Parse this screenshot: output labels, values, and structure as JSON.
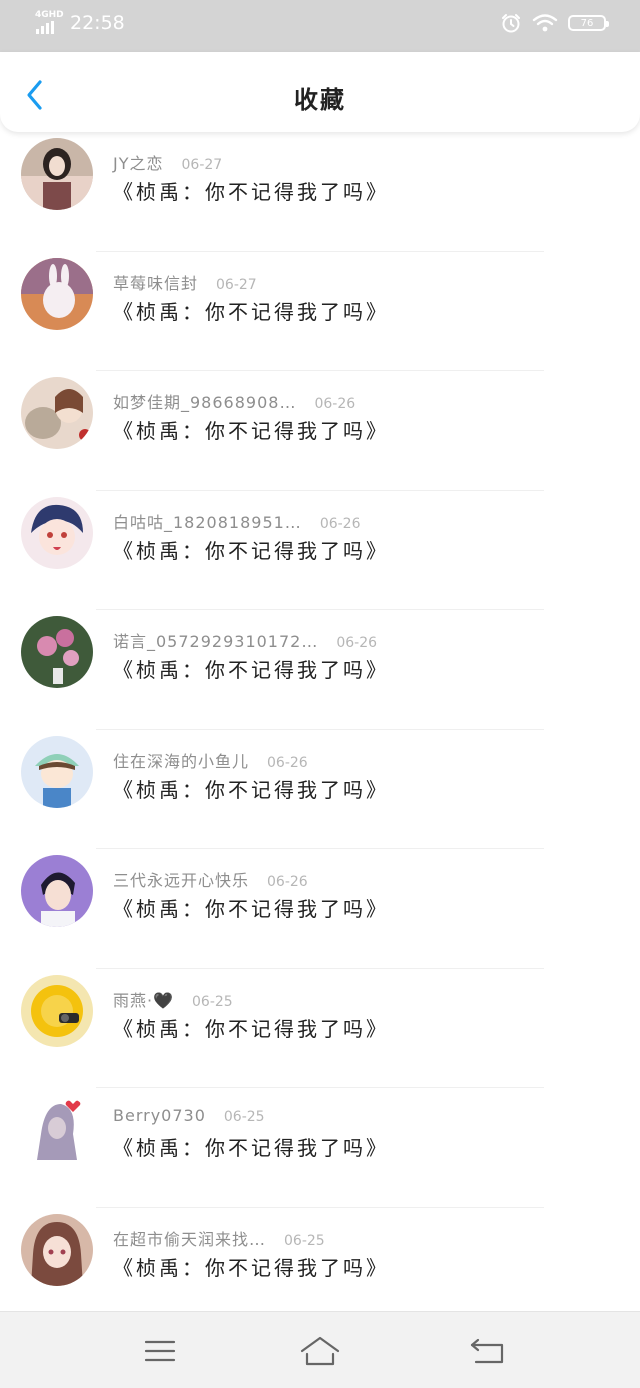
{
  "status_bar": {
    "network": "4GHD",
    "time": "22:58",
    "battery": "76"
  },
  "header": {
    "title": "收藏"
  },
  "favorites": [
    {
      "name": "JY之恋",
      "date": "06-27",
      "message": "《桢禹：你不记得我了吗》"
    },
    {
      "name": "草莓味信封",
      "date": "06-27",
      "message": "《桢禹：你不记得我了吗》"
    },
    {
      "name": "如梦佳期_98668908…",
      "date": "06-26",
      "message": "《桢禹：你不记得我了吗》"
    },
    {
      "name": "白咕咕_1820818951…",
      "date": "06-26",
      "message": "《桢禹：你不记得我了吗》"
    },
    {
      "name": "诺言_0572929310172…",
      "date": "06-26",
      "message": "《桢禹：你不记得我了吗》"
    },
    {
      "name": "住在深海的小鱼儿",
      "date": "06-26",
      "message": "《桢禹：你不记得我了吗》"
    },
    {
      "name": "三代永远开心快乐",
      "date": "06-26",
      "message": "《桢禹：你不记得我了吗》"
    },
    {
      "name": "雨燕·🖤",
      "date": "06-25",
      "message": "《桢禹：你不记得我了吗》"
    },
    {
      "name": "Berry0730",
      "date": "06-25",
      "message": "《桢禹：你不记得我了吗》"
    },
    {
      "name": "在超市偷天润来找…",
      "date": "06-25",
      "message": "《桢禹：你不记得我了吗》"
    }
  ],
  "colors": {
    "status_bar_bg": "#d4d4d4",
    "accent_blue": "#1a9cf0",
    "nav_bar_bg": "#f2f2f2"
  },
  "icons": {
    "back": "chevron-left-icon",
    "menu": "menu-icon",
    "home": "home-icon",
    "return": "return-icon"
  }
}
